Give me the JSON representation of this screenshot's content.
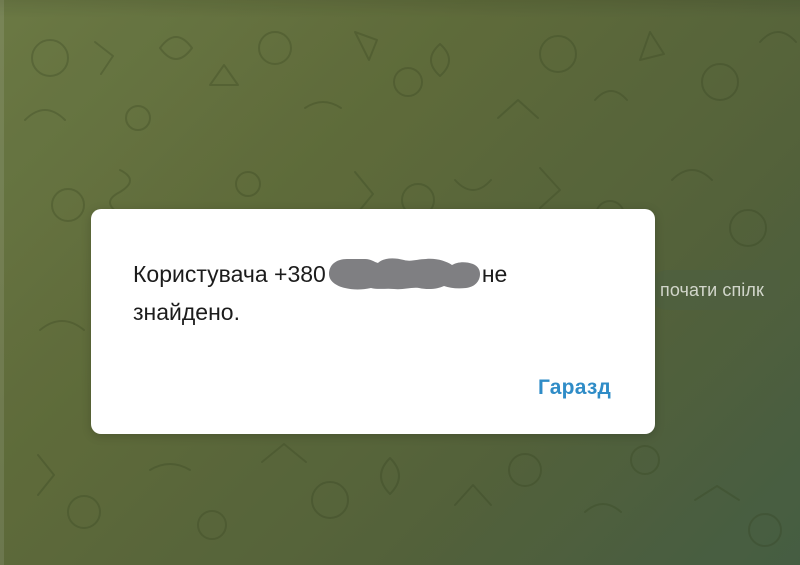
{
  "background": {
    "start_chat_label": "почати спілк"
  },
  "dialog": {
    "message_prefix": "Користувача +380",
    "message_suffix": "не",
    "message_line_2": "знайдено.",
    "ok_label": "Гаразд"
  },
  "colors": {
    "accent": "#2f8cc7",
    "dialog_background": "#ffffff",
    "wallpaper_start": "#7a8a4e",
    "wallpaper_end": "#4f6a4c"
  },
  "icons": {
    "redaction": "redaction-mask-icon"
  }
}
